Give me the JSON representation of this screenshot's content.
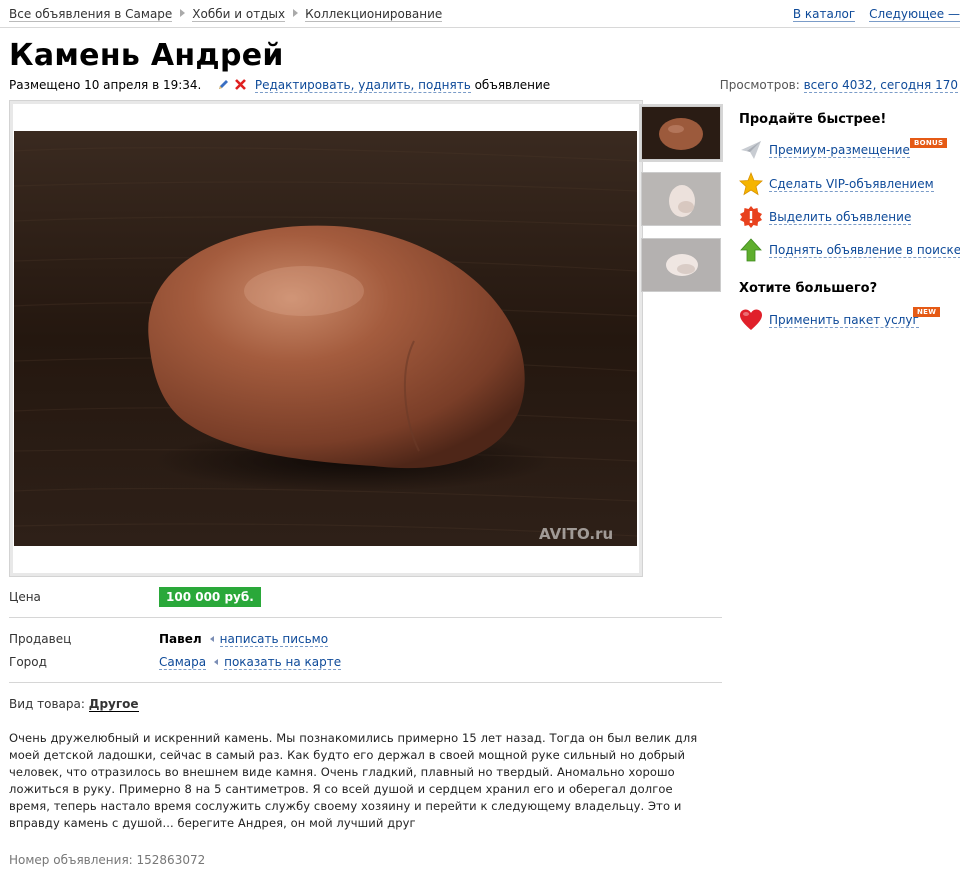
{
  "breadcrumbs": [
    "Все объявления в Самаре",
    "Хобби и отдых",
    "Коллекционирование"
  ],
  "nav": {
    "catalog": "В каталог",
    "next": "Следующее —"
  },
  "listing": {
    "title": "Камень Андрей",
    "posted": "Размещено 10 апреля в 19:34.",
    "edit_link": "Редактировать, удалить, поднять",
    "edit_suffix": "объявление",
    "views_label": "Просмотров:",
    "views_value": "всего 4032, сегодня 170",
    "watermark": "AVITO.ru"
  },
  "details": {
    "price_label": "Цена",
    "price": "100 000 руб.",
    "seller_label": "Продавец",
    "seller": "Павел",
    "write_link": "написать письмо",
    "city_label": "Город",
    "city": "Самара",
    "map_link": "показать на карте",
    "type_label": "Вид товара:",
    "type_value": "Другое",
    "description": "Очень дружелюбный и искренний камень. Мы познакомились примерно 15 лет назад. Тогда он был велик для моей детской ладошки, сейчас в самый раз. Как будто его держал в своей мощной руке сильный но добрый человек, что отразилось во внешнем виде камня. Очень гладкий, плавный но твердый. Аномально хорошо ложиться в руку. Примерно 8 на 5 сантиметров. Я со всей душой и сердцем хранил его и оберегал долгое время, теперь настало время сослужить службу своему хозяину и перейти к следующему владельцу. Это и вправду камень с душой... берегите Андрея, он мой лучший друг",
    "ad_number": "Номер объявления: 152863072"
  },
  "sidebar": {
    "sell_heading": "Продайте быстрее!",
    "premium": "Премиум-размещение",
    "premium_badge": "BONUS",
    "vip": "Сделать VIP-объявлением",
    "highlight": "Выделить объявление",
    "raise": "Поднять объявление в поиске",
    "more_heading": "Хотите большего?",
    "package": "Применить пакет услуг",
    "package_badge": "NEW"
  },
  "colors": {
    "price_bg": "#2aa83a",
    "link": "#0e4a99",
    "badge": "#e55a15"
  },
  "icons": [
    "pencil-icon",
    "delete-icon",
    "paper-plane-icon",
    "star-icon",
    "exclamation-icon",
    "up-arrow-icon",
    "heart-icon"
  ]
}
